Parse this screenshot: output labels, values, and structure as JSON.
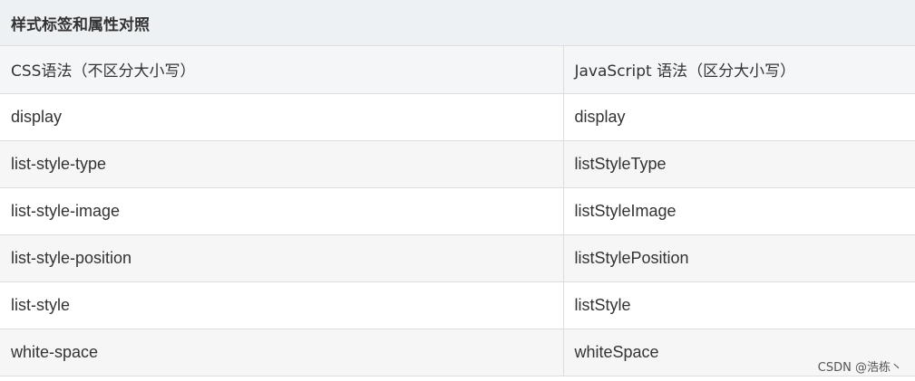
{
  "table": {
    "caption": "样式标签和属性对照",
    "headers": [
      "CSS语法（不区分大小写）",
      "JavaScript 语法（区分大小写）"
    ],
    "rows": [
      [
        "display",
        "display"
      ],
      [
        "list-style-type",
        "listStyleType"
      ],
      [
        "list-style-image",
        "listStyleImage"
      ],
      [
        "list-style-position",
        "listStylePosition"
      ],
      [
        "list-style",
        "listStyle"
      ],
      [
        "white-space",
        "whiteSpace"
      ]
    ]
  },
  "watermark": "CSDN @浩栋丶"
}
